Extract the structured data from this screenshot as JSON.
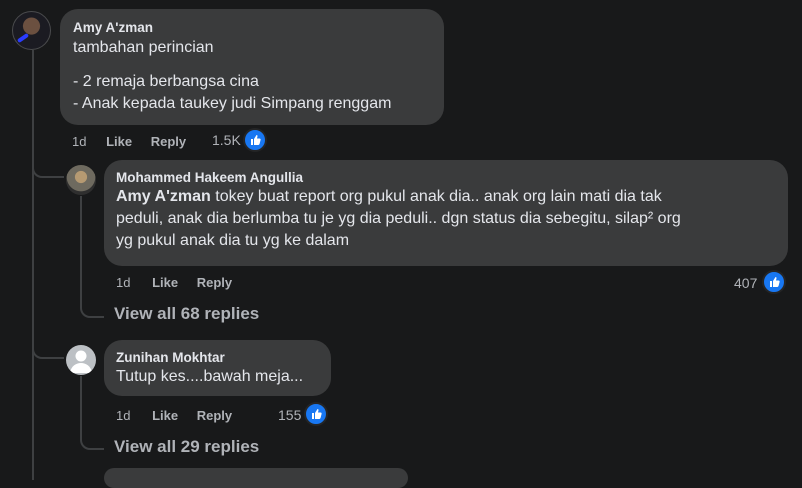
{
  "comments": [
    {
      "author": "Amy A'zman",
      "lines": [
        "tambahan perincian",
        "",
        "- 2 remaja berbangsa cina",
        "- Anak kepada taukey judi Simpang renggam"
      ],
      "time": "1d",
      "like_label": "Like",
      "reply_label": "Reply",
      "likes": "1.5K"
    },
    {
      "author": "Mohammed Hakeem Angullia",
      "mention": "Amy A'zman",
      "text": " tokey buat report org pukul anak dia.. anak org lain mati dia tak\npeduli, anak dia berlumba tu je yg dia peduli.. dgn status dia sebegitu, silap² org\nyg pukul anak dia tu yg ke dalam",
      "time": "1d",
      "like_label": "Like",
      "reply_label": "Reply",
      "likes": "407",
      "view_all": "View all 68 replies"
    },
    {
      "author": "Zunihan Mokhtar",
      "text": "Tutup kes....bawah meja...",
      "time": "1d",
      "like_label": "Like",
      "reply_label": "Reply",
      "likes": "155",
      "view_all": "View all 29 replies"
    }
  ],
  "colors": {
    "background": "#18191a",
    "bubble": "#3a3b3c",
    "like_blue": "#1877f2",
    "secondary_text": "#b0b3b8"
  }
}
